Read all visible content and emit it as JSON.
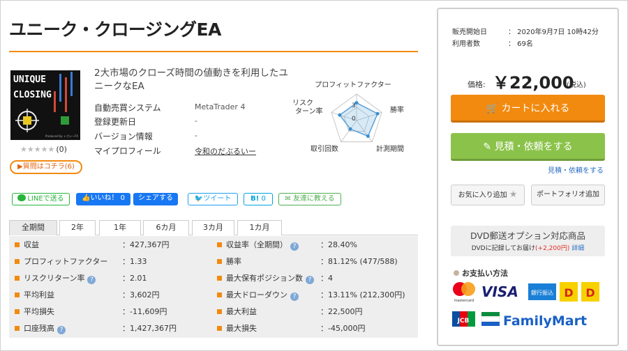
{
  "title": "ユニーク・クロージングEA",
  "thumbnail": {
    "line1": "UNIQUE",
    "line2": "CLOSING",
    "footer": "Produced by レガシーFX"
  },
  "rating": {
    "stars": "★★★★★",
    "count": "(0)"
  },
  "question_button": "▶質問はコチラ(6)",
  "description": "2大市場のクローズ時間の値動きを利用したユニークなEA",
  "info": [
    {
      "label": "自動売買システム",
      "value": "MetaTrader 4"
    },
    {
      "label": "登録更新日",
      "value": "-"
    },
    {
      "label": "バージョン情報",
      "value": "-"
    },
    {
      "label": "マイプロフィール",
      "value": "令和のだぶるいー"
    }
  ],
  "radar": {
    "title": "プロフィットファクター",
    "labels": {
      "right": "勝率",
      "bottom_right": "計測期間",
      "bottom_left": "取引回数",
      "left": "リスク\nターン率"
    },
    "ticks": [
      "3",
      "0"
    ],
    "values": [
      2.0,
      2.5,
      2.2,
      1.2,
      2.0
    ]
  },
  "social": {
    "line": "LINEで送る",
    "like": "いいね！",
    "like_count": "0",
    "share": "シェアする",
    "tweet": "ツイート",
    "hatena": "B!",
    "hatena_count": "0",
    "friend": "友達に教える"
  },
  "tabs": [
    "全期間",
    "2年",
    "1年",
    "6カ月",
    "3カ月",
    "1カ月"
  ],
  "stats_left": [
    {
      "label": "収益",
      "value": "：427,367円",
      "help": false
    },
    {
      "label": "プロフィットファクター",
      "value": "：1.33",
      "help": false
    },
    {
      "label": "リスクリターン率",
      "value": "：2.01",
      "help": true
    },
    {
      "label": "平均利益",
      "value": "：3,602円",
      "help": false
    },
    {
      "label": "平均損失",
      "value": "：-11,609円",
      "help": false
    },
    {
      "label": "口座残高",
      "value": "：1,427,367円",
      "help": true
    }
  ],
  "stats_right": [
    {
      "label": "収益率（全期間）",
      "value": "：28.40%",
      "help": true
    },
    {
      "label": "勝率",
      "value": "：81.12% (477/588)",
      "help": false
    },
    {
      "label": "最大保有ポジション数",
      "value": "：4",
      "help": true
    },
    {
      "label": "最大ドローダウン",
      "value": "：13.11% (212,300円)",
      "help": true
    },
    {
      "label": "最大利益",
      "value": "：22,500円",
      "help": false
    },
    {
      "label": "最大損失",
      "value": "：-45,000円",
      "help": false
    }
  ],
  "sidebar": {
    "start_label": "販売開始日",
    "start_value": "：  2020年9月7日 10時42分",
    "users_label": "利用者数",
    "users_value": "：  69名",
    "price_label": "価格:",
    "price": "￥22,000",
    "tax": "(税込)",
    "cart_button": "カートに入れる",
    "estimate_button": "見積・依頼をする",
    "estimate_link": "見積・依頼をする",
    "favorite_button": "お気に入り追加",
    "portfolio_button": "ポートフォリオ追加",
    "dvd_title": "DVD郵送オプション対応商品",
    "dvd_note": "DVDに記録してお届け",
    "dvd_price": "(+2,200円)",
    "dvd_link": "詳細",
    "payment_title": "お支払い方法",
    "payments": [
      "mastercard",
      "VISA",
      "銀行振込",
      "paidy",
      "Daily",
      "JCB",
      "FamilyMart"
    ]
  },
  "colors": {
    "accent": "#f28a0f",
    "green": "#8bc34a",
    "link": "#2a6fc2"
  }
}
